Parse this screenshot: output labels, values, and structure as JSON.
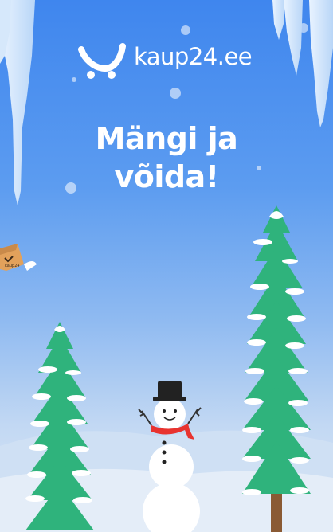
{
  "brand": {
    "name": "kaup24.ee",
    "icon": "shopping-cart-logo-icon",
    "color": "#ffffff"
  },
  "headline": {
    "line1": "Mängi ja",
    "line2": "võida!"
  },
  "box_label": "kaup24",
  "colors": {
    "sky_top": "#3f86ee",
    "sky_bottom": "#dfe9f5",
    "tree": "#2fb37c",
    "snow": "#ffffff",
    "box": "#e2a15b",
    "scarf": "#e8332f",
    "hat": "#222222"
  }
}
